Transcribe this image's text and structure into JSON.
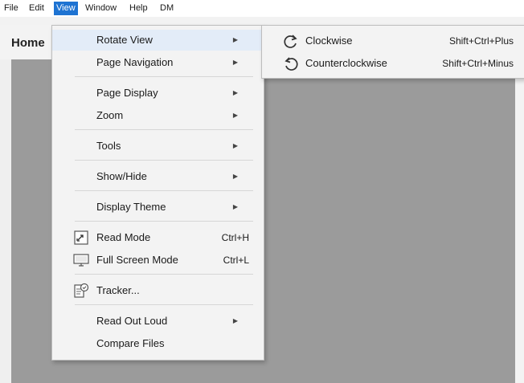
{
  "menubar": {
    "items": [
      {
        "label": "File"
      },
      {
        "label": "Edit"
      },
      {
        "label": "View"
      },
      {
        "label": "Window"
      },
      {
        "label": "Help"
      },
      {
        "label": "DM"
      }
    ]
  },
  "toolbar": {
    "home_label": "Home"
  },
  "view_menu": {
    "rotate_view": {
      "label": "Rotate View"
    },
    "page_navigation": {
      "label": "Page Navigation"
    },
    "page_display": {
      "label": "Page Display"
    },
    "zoom": {
      "label": "Zoom"
    },
    "tools": {
      "label": "Tools"
    },
    "show_hide": {
      "label": "Show/Hide"
    },
    "display_theme": {
      "label": "Display Theme"
    },
    "read_mode": {
      "label": "Read Mode",
      "shortcut": "Ctrl+H"
    },
    "full_screen_mode": {
      "label": "Full Screen Mode",
      "shortcut": "Ctrl+L"
    },
    "tracker": {
      "label": "Tracker..."
    },
    "read_out_loud": {
      "label": "Read Out Loud"
    },
    "compare_files": {
      "label": "Compare Files"
    }
  },
  "rotate_submenu": {
    "clockwise": {
      "label": "Clockwise",
      "shortcut": "Shift+Ctrl+Plus"
    },
    "counterclockwise": {
      "label": "Counterclockwise",
      "shortcut": "Shift+Ctrl+Minus"
    }
  },
  "colors": {
    "menu_highlight": "#1e73d2",
    "hover_row": "#e3ecf8",
    "document_gray": "#9b9b9b"
  }
}
